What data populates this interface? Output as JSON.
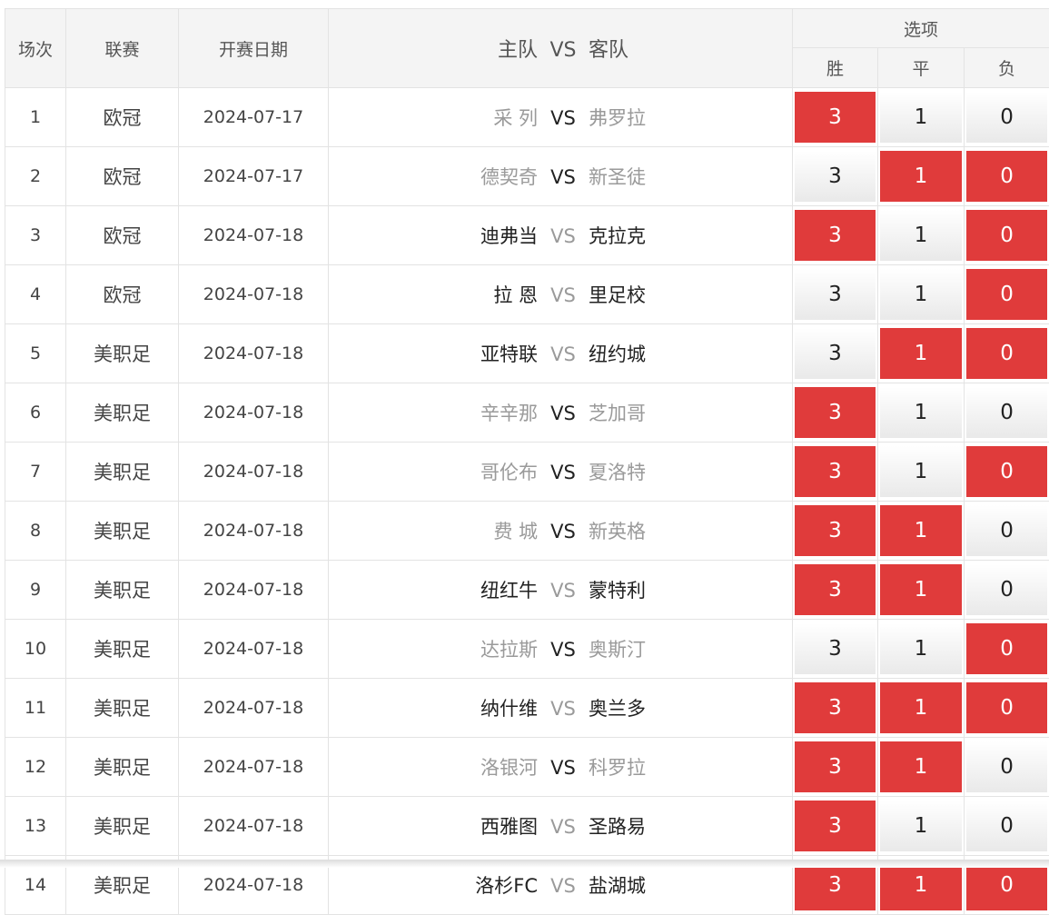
{
  "header": {
    "match_no": "场次",
    "league": "联赛",
    "date": "开赛日期",
    "home_team": "主队",
    "vs": "VS",
    "away_team": "客队",
    "options": "选项",
    "win": "胜",
    "draw": "平",
    "loss": "负"
  },
  "colors": {
    "selected": "#e03b3b",
    "border": "#e3e3e3",
    "header_bg": "#f4f4f4",
    "muted_team": "#9a9a9a"
  },
  "rows": [
    {
      "no": "1",
      "league": "欧冠",
      "date": "2024-07-17",
      "home": "采 列",
      "away": "弗罗拉",
      "dark": "none",
      "opts": [
        "3",
        "1",
        "0"
      ],
      "sel": [
        true,
        false,
        false
      ]
    },
    {
      "no": "2",
      "league": "欧冠",
      "date": "2024-07-17",
      "home": "德契奇",
      "away": "新圣徒",
      "dark": "none",
      "opts": [
        "3",
        "1",
        "0"
      ],
      "sel": [
        false,
        true,
        true
      ]
    },
    {
      "no": "3",
      "league": "欧冠",
      "date": "2024-07-18",
      "home": "迪弗当",
      "away": "克拉克",
      "dark": "both",
      "opts": [
        "3",
        "1",
        "0"
      ],
      "sel": [
        true,
        false,
        true
      ]
    },
    {
      "no": "4",
      "league": "欧冠",
      "date": "2024-07-18",
      "home": "拉 恩",
      "away": "里足校",
      "dark": "both",
      "opts": [
        "3",
        "1",
        "0"
      ],
      "sel": [
        false,
        false,
        true
      ]
    },
    {
      "no": "5",
      "league": "美职足",
      "date": "2024-07-18",
      "home": "亚特联",
      "away": "纽约城",
      "dark": "both",
      "opts": [
        "3",
        "1",
        "0"
      ],
      "sel": [
        false,
        true,
        true
      ]
    },
    {
      "no": "6",
      "league": "美职足",
      "date": "2024-07-18",
      "home": "辛辛那",
      "away": "芝加哥",
      "dark": "none",
      "opts": [
        "3",
        "1",
        "0"
      ],
      "sel": [
        true,
        false,
        false
      ]
    },
    {
      "no": "7",
      "league": "美职足",
      "date": "2024-07-18",
      "home": "哥伦布",
      "away": "夏洛特",
      "dark": "none",
      "opts": [
        "3",
        "1",
        "0"
      ],
      "sel": [
        true,
        false,
        true
      ]
    },
    {
      "no": "8",
      "league": "美职足",
      "date": "2024-07-18",
      "home": "费 城",
      "away": "新英格",
      "dark": "none",
      "opts": [
        "3",
        "1",
        "0"
      ],
      "sel": [
        true,
        true,
        false
      ]
    },
    {
      "no": "9",
      "league": "美职足",
      "date": "2024-07-18",
      "home": "纽红牛",
      "away": "蒙特利",
      "dark": "both",
      "opts": [
        "3",
        "1",
        "0"
      ],
      "sel": [
        true,
        true,
        false
      ]
    },
    {
      "no": "10",
      "league": "美职足",
      "date": "2024-07-18",
      "home": "达拉斯",
      "away": "奥斯汀",
      "dark": "none",
      "opts": [
        "3",
        "1",
        "0"
      ],
      "sel": [
        false,
        false,
        true
      ]
    },
    {
      "no": "11",
      "league": "美职足",
      "date": "2024-07-18",
      "home": "纳什维",
      "away": "奥兰多",
      "dark": "both",
      "opts": [
        "3",
        "1",
        "0"
      ],
      "sel": [
        true,
        true,
        true
      ]
    },
    {
      "no": "12",
      "league": "美职足",
      "date": "2024-07-18",
      "home": "洛银河",
      "away": "科罗拉",
      "dark": "none",
      "opts": [
        "3",
        "1",
        "0"
      ],
      "sel": [
        true,
        true,
        false
      ]
    },
    {
      "no": "13",
      "league": "美职足",
      "date": "2024-07-18",
      "home": "西雅图",
      "away": "圣路易",
      "dark": "both",
      "opts": [
        "3",
        "1",
        "0"
      ],
      "sel": [
        true,
        false,
        false
      ]
    },
    {
      "no": "14",
      "league": "美职足",
      "date": "2024-07-18",
      "home": "洛杉FC",
      "away": "盐湖城",
      "dark": "both",
      "opts": [
        "3",
        "1",
        "0"
      ],
      "sel": [
        true,
        true,
        true
      ]
    }
  ]
}
